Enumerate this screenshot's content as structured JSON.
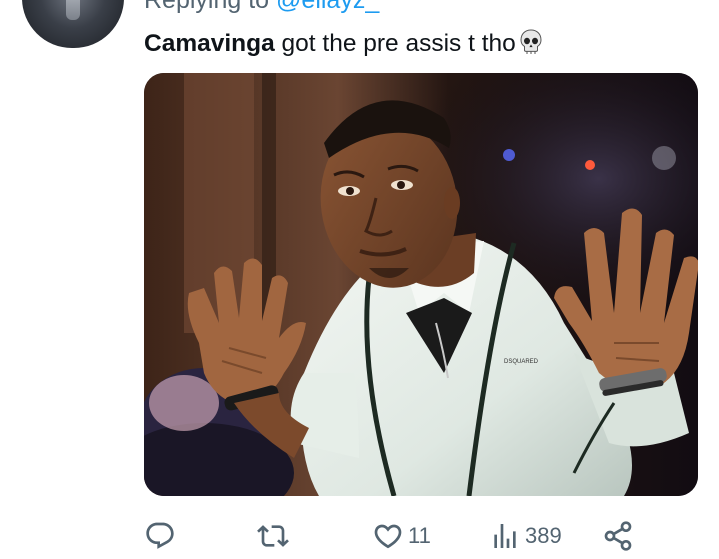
{
  "reply": {
    "prefix": "Replying to",
    "handle": "@eliayz_"
  },
  "tweet": {
    "mention": "Camavinga",
    "text": " got the pre assis t tho",
    "emoji": "skull"
  },
  "media": {
    "shirt_label": "DSQUARED"
  },
  "actions": {
    "reply": {
      "icon": "reply-icon",
      "count": ""
    },
    "retweet": {
      "icon": "retweet-icon",
      "count": ""
    },
    "like": {
      "icon": "heart-icon",
      "count": "11"
    },
    "views": {
      "icon": "views-icon",
      "count": "389"
    },
    "share": {
      "icon": "share-icon",
      "count": ""
    }
  },
  "colors": {
    "text": "#0f1419",
    "secondary": "#536471",
    "link": "#1d9bf0"
  }
}
